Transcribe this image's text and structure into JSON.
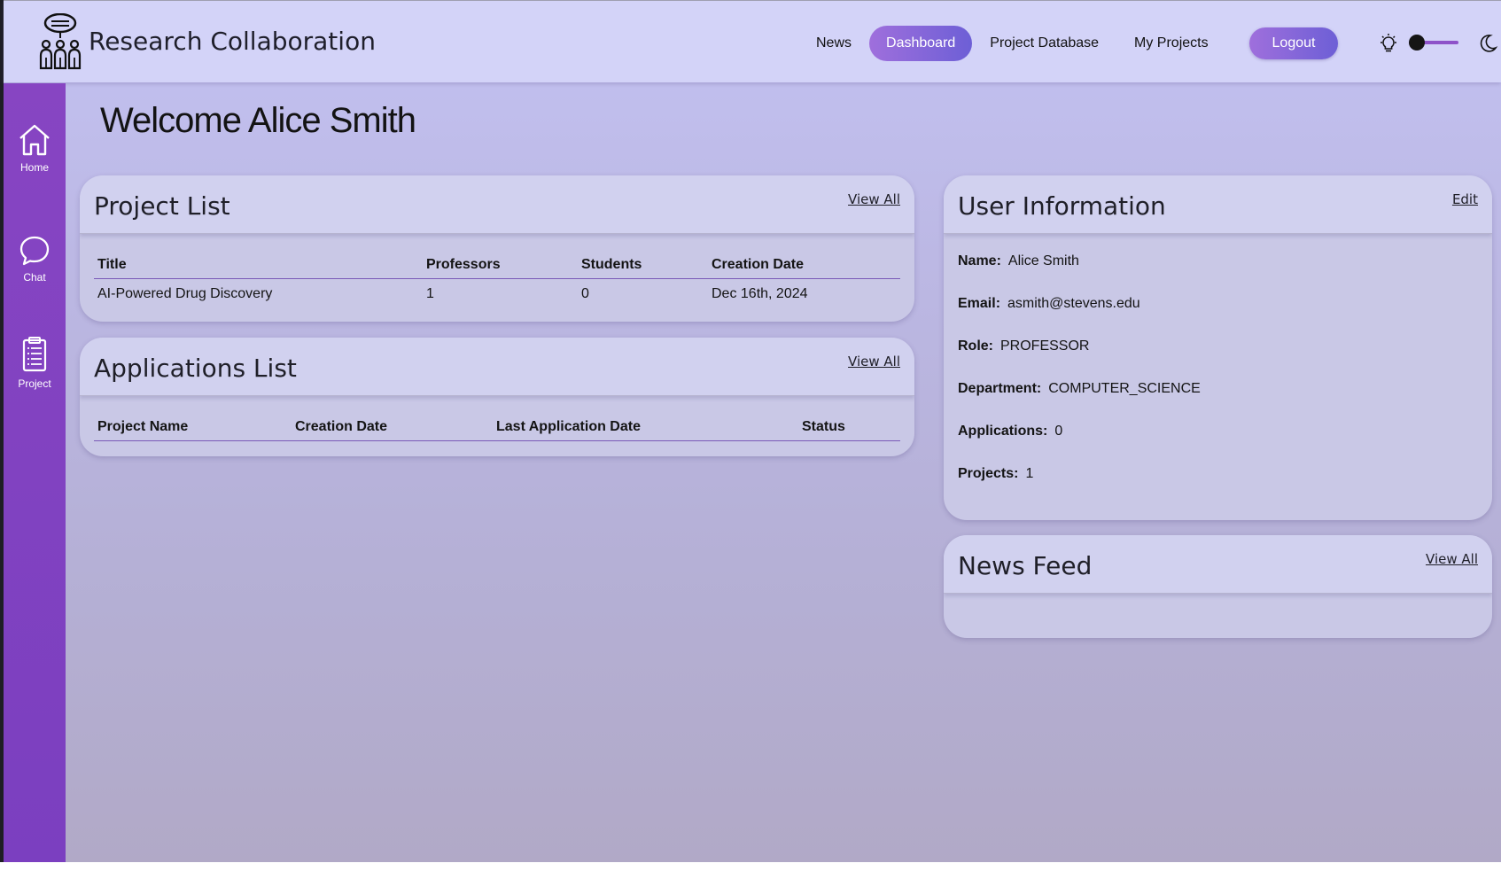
{
  "header": {
    "brand": "Research Collaboration",
    "nav": [
      {
        "label": "News"
      },
      {
        "label": "Dashboard",
        "active": true
      },
      {
        "label": "Project Database"
      },
      {
        "label": "My Projects"
      }
    ],
    "logout_label": "Logout",
    "theme_toggle": {
      "left_icon": "lightbulb-icon",
      "right_icon": "moon-icon",
      "state": "light"
    }
  },
  "sidebar": {
    "items": [
      {
        "label": "Home",
        "icon": "home-icon"
      },
      {
        "label": "Chat",
        "icon": "chat-bubble-icon"
      },
      {
        "label": "Project",
        "icon": "clipboard-list-icon"
      }
    ]
  },
  "main": {
    "welcome": "Welcome Alice Smith",
    "project_list": {
      "title": "Project List",
      "view_all": "View All",
      "columns": [
        "Title",
        "Professors",
        "Students",
        "Creation Date"
      ],
      "rows": [
        [
          "AI-Powered Drug Discovery",
          "1",
          "0",
          "Dec 16th, 2024"
        ]
      ]
    },
    "applications_list": {
      "title": "Applications List",
      "view_all": "View All",
      "columns": [
        "Project Name",
        "Creation Date",
        "Last Application Date",
        "Status"
      ],
      "rows": []
    },
    "user_info": {
      "title": "User Information",
      "edit": "Edit",
      "fields": [
        {
          "label": "Name:",
          "value": "Alice Smith"
        },
        {
          "label": "Email:",
          "value": "asmith@stevens.edu"
        },
        {
          "label": "Role:",
          "value": "PROFESSOR"
        },
        {
          "label": "Department:",
          "value": "COMPUTER_SCIENCE"
        },
        {
          "label": "Applications:",
          "value": "0"
        },
        {
          "label": "Projects:",
          "value": "1"
        }
      ]
    },
    "news_feed": {
      "title": "News Feed",
      "view_all": "View All"
    }
  },
  "colors": {
    "accent_gradient_start": "#9f6fdc",
    "accent_gradient_end": "#6d5fd6",
    "sidebar": "#8745c2",
    "header_bg": "#d3d3f8"
  }
}
